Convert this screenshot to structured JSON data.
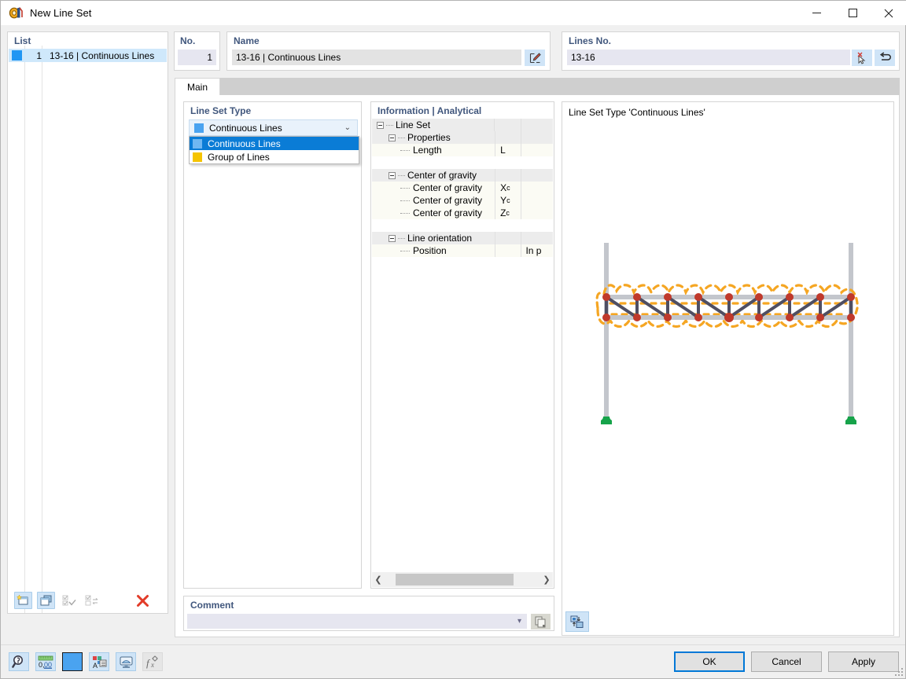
{
  "window": {
    "title": "New Line Set",
    "icon": "line-set-icon",
    "minimize_label": "Minimize",
    "maximize_label": "Maximize",
    "close_label": "Close"
  },
  "list_panel": {
    "header": "List",
    "rows": [
      {
        "color": "#2196f3",
        "no": "1",
        "name": "13-16 | Continuous Lines"
      }
    ],
    "toolbar": [
      {
        "name": "new-line-set-button",
        "enabled": true
      },
      {
        "name": "copy-line-set-button",
        "enabled": true
      },
      {
        "name": "select-all-button",
        "enabled": false
      },
      {
        "name": "invert-selection-button",
        "enabled": false
      },
      {
        "name": "delete-line-set-button",
        "enabled": true
      }
    ]
  },
  "no_card": {
    "header": "No.",
    "value": "1"
  },
  "name_card": {
    "header": "Name",
    "value": "13-16 | Continuous Lines",
    "edit_button": "edit-name-button"
  },
  "lines_card": {
    "header": "Lines No.",
    "value": "13-16",
    "pick_button": "pick-lines-button",
    "undo_button": "undo-selection-button"
  },
  "tabs": [
    {
      "label": "Main",
      "active": true
    }
  ],
  "line_set_type": {
    "header": "Line Set Type",
    "selected": {
      "label": "Continuous Lines",
      "color": "#4aa3f0"
    },
    "options": [
      {
        "label": "Continuous Lines",
        "color": "#6fb7f2",
        "selected": true
      },
      {
        "label": "Group of Lines",
        "color": "#f5c400",
        "selected": false
      }
    ]
  },
  "information": {
    "header": "Information | Analytical",
    "rows": [
      {
        "label": "Line Set",
        "indent": 0,
        "expander": true,
        "symbol": "",
        "value": "",
        "style": "band"
      },
      {
        "label": "Properties",
        "indent": 1,
        "expander": true,
        "symbol": "",
        "value": "",
        "style": "band"
      },
      {
        "label": "Length",
        "indent": 2,
        "expander": false,
        "symbol": "L",
        "value": "",
        "style": "cream"
      },
      {
        "label": "",
        "indent": 0,
        "expander": false,
        "symbol": "",
        "value": "",
        "style": "white"
      },
      {
        "label": "Center of gravity",
        "indent": 1,
        "expander": true,
        "symbol": "",
        "value": "",
        "style": "band"
      },
      {
        "label": "Center of gravity",
        "indent": 2,
        "expander": false,
        "symbol": "Xc",
        "value": "",
        "style": "cream"
      },
      {
        "label": "Center of gravity",
        "indent": 2,
        "expander": false,
        "symbol": "Yc",
        "value": "",
        "style": "cream"
      },
      {
        "label": "Center of gravity",
        "indent": 2,
        "expander": false,
        "symbol": "Zc",
        "value": "",
        "style": "cream"
      },
      {
        "label": "",
        "indent": 0,
        "expander": false,
        "symbol": "",
        "value": "",
        "style": "white"
      },
      {
        "label": "Line orientation",
        "indent": 1,
        "expander": true,
        "symbol": "",
        "value": "",
        "style": "band"
      },
      {
        "label": "Position",
        "indent": 2,
        "expander": false,
        "symbol": "",
        "value": "In p",
        "style": "cream"
      }
    ],
    "scroll_left_label": "❮",
    "scroll_right_label": "❯"
  },
  "view": {
    "title": "Line Set Type 'Continuous Lines'",
    "toolbar_button": "view-layout-button",
    "graphic": {
      "member_color": "#4f4f63",
      "chord_color": "#c3c6cc",
      "node_color": "#c0392b",
      "highlight_color": "#f5a623",
      "support_color": "#16a34a"
    }
  },
  "comment": {
    "header": "Comment",
    "value": "",
    "placeholder": "",
    "copy_button": "copy-comment-button"
  },
  "bottom_bar": {
    "tools": [
      {
        "name": "search-tool-button",
        "enabled": true
      },
      {
        "name": "decimal-places-button",
        "enabled": true
      },
      {
        "name": "color-swatch-button",
        "enabled": true,
        "color": "#4aa3f0"
      },
      {
        "name": "display-properties-button",
        "enabled": true
      },
      {
        "name": "view-settings-button",
        "enabled": true
      },
      {
        "name": "formula-button",
        "enabled": false
      }
    ],
    "actions": [
      {
        "label": "OK",
        "name": "ok-button",
        "primary": true
      },
      {
        "label": "Cancel",
        "name": "cancel-button",
        "primary": false
      },
      {
        "label": "Apply",
        "name": "apply-button",
        "primary": false
      }
    ]
  }
}
